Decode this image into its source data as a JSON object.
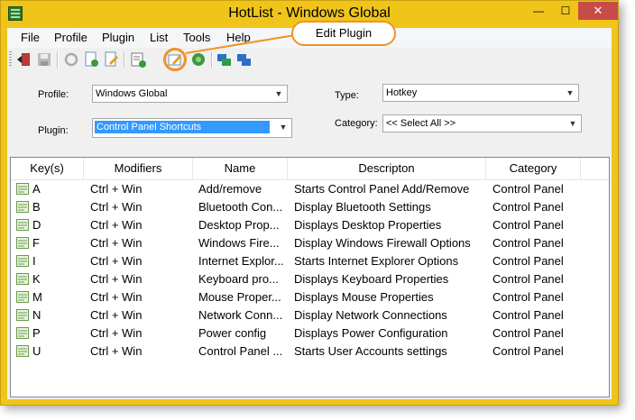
{
  "window": {
    "title": "HotList - Windows Global",
    "min_label": "—",
    "max_label": "☐",
    "close_label": "✕"
  },
  "menu": [
    "File",
    "Profile",
    "Plugin",
    "List",
    "Tools",
    "Help"
  ],
  "toolbar": {
    "buttons": [
      "exit-icon",
      "save-icon",
      "refresh-icon",
      "new-profile-icon",
      "edit-profile-icon",
      "add-list-icon",
      "edit-plugin-icon",
      "green-circle-icon",
      "window-move-icon",
      "window-swap-icon"
    ]
  },
  "callout": {
    "text": "Edit Plugin"
  },
  "form": {
    "profile_label": "Profile:",
    "profile_value": "Windows Global",
    "plugin_label": "Plugin:",
    "plugin_value": "Control Panel Shortcuts",
    "type_label": "Type:",
    "type_value": "Hotkey",
    "category_label": "Category:",
    "category_value": "<< Select All >>"
  },
  "table": {
    "columns": [
      "Key(s)",
      "Modifiers",
      "Name",
      "Descripton",
      "Category"
    ],
    "rows": [
      [
        "A",
        "Ctrl + Win",
        "Add/remove",
        "Starts Control Panel Add/Remove",
        "Control Panel"
      ],
      [
        "B",
        "Ctrl + Win",
        "Bluetooth Con...",
        "Display Bluetooth Settings",
        "Control Panel"
      ],
      [
        "D",
        "Ctrl + Win",
        "Desktop Prop...",
        "Displays Desktop Properties",
        "Control Panel"
      ],
      [
        "F",
        "Ctrl + Win",
        "Windows Fire...",
        "Display Windows Firewall Options",
        "Control Panel"
      ],
      [
        "I",
        "Ctrl + Win",
        "Internet Explor...",
        "Starts Internet Explorer Options",
        "Control Panel"
      ],
      [
        "K",
        "Ctrl + Win",
        "Keyboard pro...",
        "Displays Keyboard Properties",
        "Control Panel"
      ],
      [
        "M",
        "Ctrl + Win",
        "Mouse Proper...",
        "Displays Mouse Properties",
        "Control Panel"
      ],
      [
        "N",
        "Ctrl + Win",
        "Network Conn...",
        "Display Network Connections",
        "Control Panel"
      ],
      [
        "P",
        "Ctrl + Win",
        "Power config",
        "Displays Power Configuration",
        "Control Panel"
      ],
      [
        "U",
        "Ctrl + Win",
        "Control Panel ...",
        "Starts User Accounts settings",
        "Control Panel"
      ]
    ]
  },
  "colors": {
    "window_frame": "#f0c419",
    "close_button": "#c74b47",
    "selection": "#3399ff",
    "callout_border": "#f0922a"
  }
}
